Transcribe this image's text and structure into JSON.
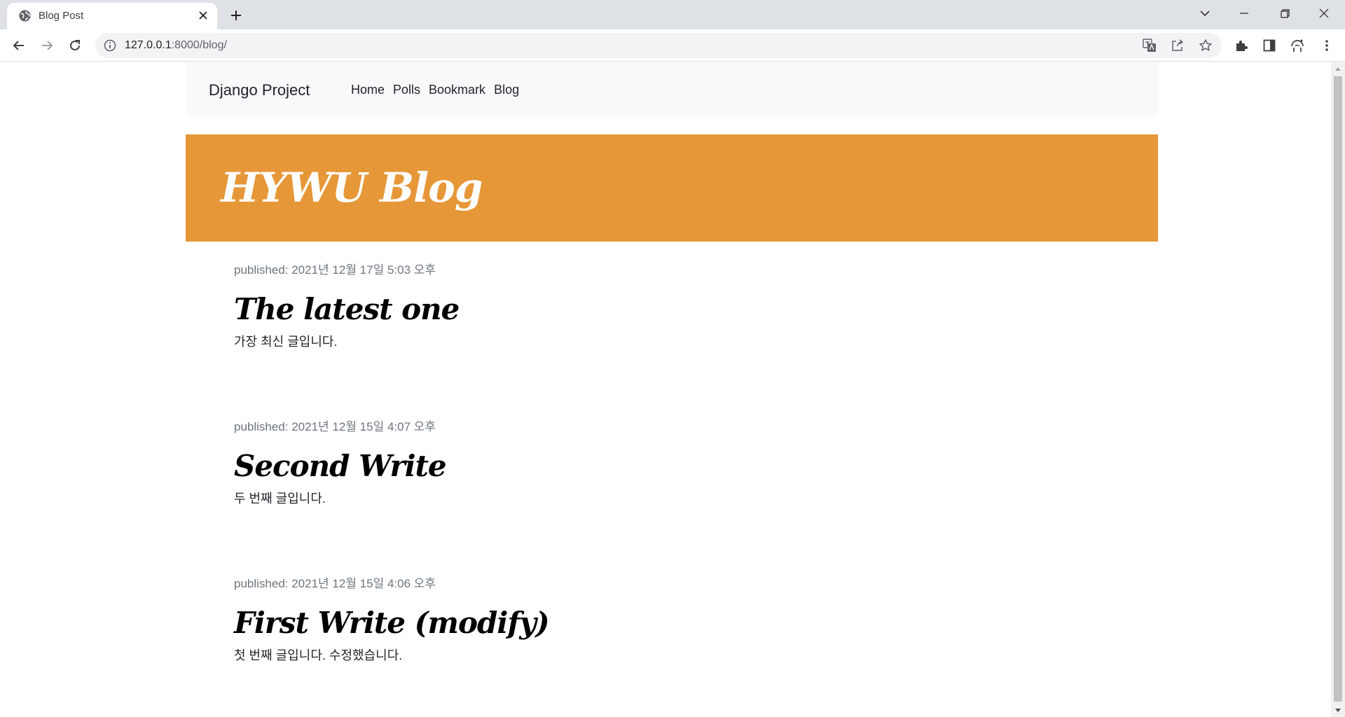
{
  "browser": {
    "tab": {
      "title": "Blog Post"
    },
    "url": {
      "host": "127.0.0.1",
      "rest": ":8000/blog/"
    }
  },
  "navbar": {
    "brand": "Django Project",
    "links": [
      "Home",
      "Polls",
      "Bookmark",
      "Blog"
    ]
  },
  "hero": {
    "title": "HYWU Blog"
  },
  "posts": [
    {
      "meta": "published: 2021년 12월 17일 5:03 오후",
      "title": "The latest one",
      "body": "가장 최신 글입니다."
    },
    {
      "meta": "published: 2021년 12월 15일 4:07 오후",
      "title": "Second Write",
      "body": "두 번째 글입니다."
    },
    {
      "meta": "published: 2021년 12월 15일 4:06 오후",
      "title": "First Write (modify)",
      "body": "첫 번째 글입니다. 수정했습니다."
    }
  ],
  "colors": {
    "hero_bg": "#e69737",
    "navbar_bg": "#f8f9fa",
    "meta_text": "#6c757d"
  }
}
